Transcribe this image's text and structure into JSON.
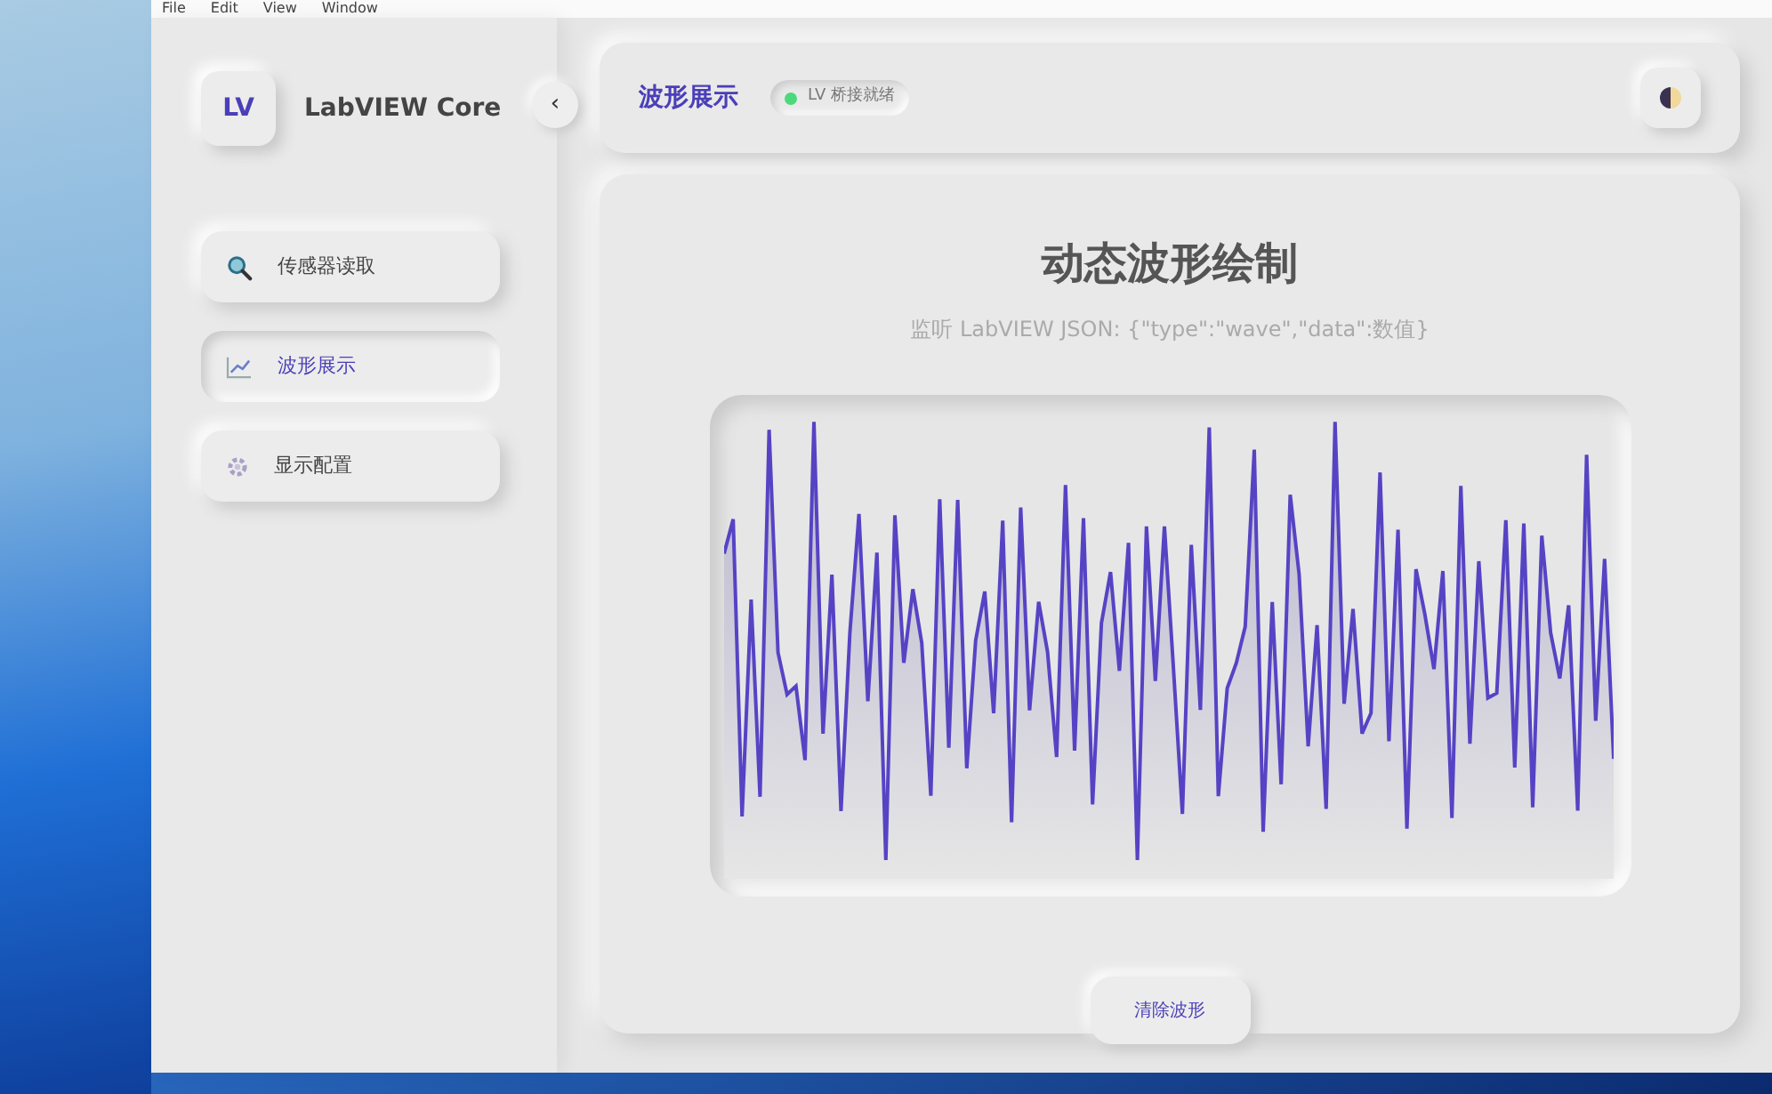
{
  "menu_bar": {
    "items": [
      "File",
      "Edit",
      "View",
      "Window"
    ]
  },
  "sidebar": {
    "logo": "LV",
    "title": "LabVIEW Core",
    "collapse": "‹",
    "items": [
      {
        "label": "传感器读取",
        "selected": false
      },
      {
        "label": "波形展示",
        "selected": true
      },
      {
        "label": "显示配置",
        "selected": false
      }
    ]
  },
  "header": {
    "title": "波形展示",
    "status": {
      "label": "LV 桥接就绪",
      "color": "#4cd97b"
    }
  },
  "panel": {
    "title": "动态波形绘制",
    "subtitle": "监听 LabVIEW JSON: {\"type\":\"wave\",\"data\":数值}",
    "button": "清除波形"
  }
}
